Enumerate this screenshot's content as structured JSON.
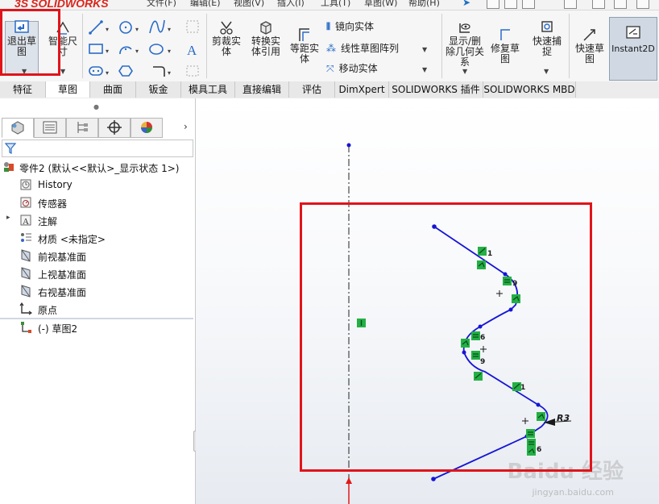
{
  "app": {
    "logo": "SOLIDWORKS",
    "logo_prefix": "3S"
  },
  "menu": [
    {
      "label": "文件(F)"
    },
    {
      "label": "编辑(E)"
    },
    {
      "label": "视图(V)"
    },
    {
      "label": "插入(I)"
    },
    {
      "label": "工具(T)"
    },
    {
      "label": "草图(W)"
    },
    {
      "label": "帮助(H)"
    }
  ],
  "ribbon": {
    "exit_sketch": "退出草图",
    "smart_dimension": "智能尺寸",
    "trim": "剪裁实体",
    "convert": "转换实体引用",
    "offset": "等距实体",
    "mirror": "镜向实体",
    "linear_pattern": "线性草图阵列",
    "move": "移动实体",
    "display_relations": "显示/删除几何关系",
    "repair": "修复草图",
    "quick_snaps": "快速捕捉",
    "rapid_sketch": "快速草图",
    "instant2d": "Instant2D"
  },
  "tabs": [
    {
      "label": "特征"
    },
    {
      "label": "草图"
    },
    {
      "label": "曲面"
    },
    {
      "label": "钣金"
    },
    {
      "label": "模具工具"
    },
    {
      "label": "直接编辑"
    },
    {
      "label": "评估"
    },
    {
      "label": "DimXpert"
    },
    {
      "label": "SOLIDWORKS 插件"
    },
    {
      "label": "SOLIDWORKS MBD"
    }
  ],
  "active_tab": "草图",
  "tree": {
    "root": "零件2  (默认<<默认>_显示状态 1>)",
    "items": [
      {
        "label": "History",
        "icon": "history-folder-icon"
      },
      {
        "label": "传感器",
        "icon": "sensor-icon"
      },
      {
        "label": "注解",
        "icon": "annotation-icon"
      },
      {
        "label": "材质 <未指定>",
        "icon": "material-icon"
      },
      {
        "label": "前视基准面",
        "icon": "plane-icon"
      },
      {
        "label": "上视基准面",
        "icon": "plane-icon"
      },
      {
        "label": "右视基准面",
        "icon": "plane-icon"
      },
      {
        "label": "原点",
        "icon": "origin-icon"
      },
      {
        "label": "(-) 草图2",
        "icon": "sketch-icon"
      }
    ]
  },
  "sketch": {
    "relation_labels": [
      "1",
      "9",
      "6",
      "9",
      "1",
      "6"
    ],
    "dimension": "R3"
  },
  "watermark": {
    "text": "Baidu 经验",
    "sub": "jingyan.baidu.com"
  },
  "colors": {
    "highlight": "#e0141a",
    "sketch_line": "#1515d6",
    "relation_badge": "#23b045"
  }
}
